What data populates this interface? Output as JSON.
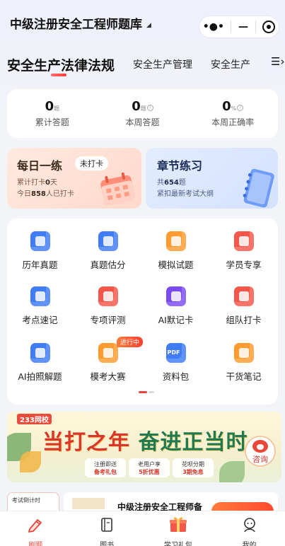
{
  "header": {
    "title": "中级注册安全工程师题库",
    "capsule": {
      "more": "•●•",
      "minimize": "—"
    }
  },
  "tabs": [
    {
      "label": "安全生产法律法规",
      "active": true
    },
    {
      "label": "安全生产管理",
      "active": false
    },
    {
      "label": "安全生产",
      "active": false
    }
  ],
  "stats": [
    {
      "value": "0",
      "unit": "题",
      "label": "累计答题",
      "help": false
    },
    {
      "value": "0",
      "unit": "题",
      "label": "本周答题",
      "help": true
    },
    {
      "value": "0",
      "unit": "%",
      "label": "本周正确率",
      "help": true
    }
  ],
  "daily": {
    "title": "每日一练",
    "badge": "未打卡",
    "line1_prefix": "累计打卡",
    "line1_value": "0",
    "line1_suffix": "天",
    "line2_prefix": "今日",
    "line2_value": "858",
    "line2_suffix": "人已打卡"
  },
  "chapter": {
    "title": "章节练习",
    "line1_prefix": "共",
    "line1_value": "654",
    "line1_suffix": "题",
    "line2": "紧扣最新考试大纲"
  },
  "grid": [
    {
      "label": "历年真题",
      "icon": "past-papers-icon",
      "color": "#3f7cf5"
    },
    {
      "label": "真题估分",
      "icon": "score-estimate-icon",
      "color": "#3f7cf5"
    },
    {
      "label": "模拟试题",
      "icon": "mock-test-icon",
      "color": "#ff9b2f"
    },
    {
      "label": "学员专享",
      "icon": "member-exclusive-icon",
      "color": "#f4574a"
    },
    {
      "label": "考点速记",
      "icon": "key-points-icon",
      "color": "#3f7cf5"
    },
    {
      "label": "专项评测",
      "icon": "special-assessment-icon",
      "color": "#f4574a"
    },
    {
      "label": "AI默记卡",
      "icon": "ai-flashcard-icon",
      "color": "#7a4cf0"
    },
    {
      "label": "组队打卡",
      "icon": "team-checkin-icon",
      "color": "#f4574a"
    },
    {
      "label": "AI拍照解题",
      "icon": "ai-photo-solve-icon",
      "color": "#3f7cf5"
    },
    {
      "label": "模考大赛",
      "icon": "mock-contest-icon",
      "color": "#ff9b2f",
      "badge": "进行中"
    },
    {
      "label": "资料包",
      "icon": "pdf-pack-icon",
      "color": "#3f7cf5",
      "pdf": "PDF"
    },
    {
      "label": "干货笔记",
      "icon": "notes-icon",
      "color": "#ff9b2f"
    }
  ],
  "banner": {
    "brand": "233网校",
    "slogan_a": "当打之年",
    "slogan_b": "奋进正当时",
    "promos": [
      {
        "top": "注册即送",
        "bottom": "备考礼包"
      },
      {
        "top": "老用户享",
        "bottom": "5折优惠"
      },
      {
        "top": "花呗分期",
        "bottom": "3期免息"
      }
    ],
    "consult": "咨询"
  },
  "peek": {
    "countdown": "考试倒计时",
    "exam_name": "中级注册安全工程师备"
  },
  "tabbar": [
    {
      "label": "刷题",
      "icon": "pen-icon",
      "active": true
    },
    {
      "label": "图书",
      "icon": "book-icon",
      "active": false
    },
    {
      "label": "学习礼包",
      "icon": "gift-icon",
      "active": false
    },
    {
      "label": "我的",
      "icon": "profile-icon",
      "active": false
    }
  ],
  "colors": {
    "accent": "#e8453c",
    "primary_blue": "#3f7cf5"
  }
}
